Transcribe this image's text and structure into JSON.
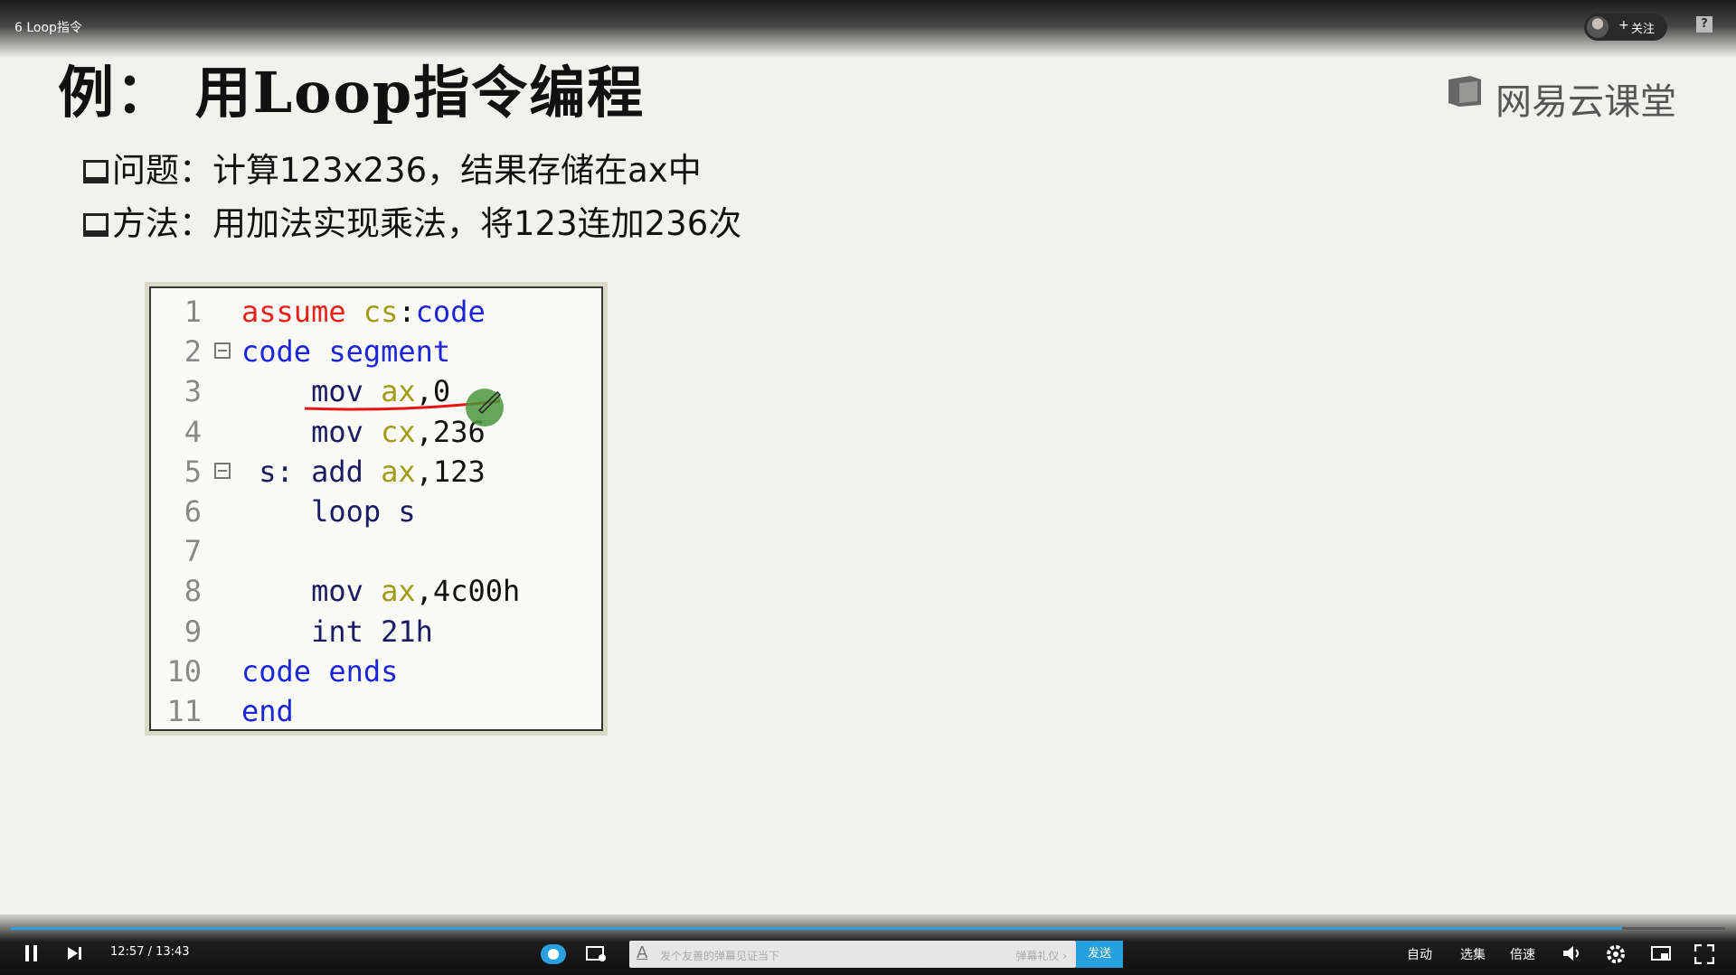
{
  "video": {
    "title": "6 Loop指令"
  },
  "header": {
    "follow_plus": "+",
    "follow_label": "关注",
    "help_label": "?"
  },
  "slide": {
    "heading": "例： 用Loop指令编程",
    "brand": "网易云课堂",
    "bullets": [
      "问题：计算123x236，结果存储在ax中",
      "方法：用加法实现乘法，将123连加236次"
    ],
    "code": {
      "line_numbers": [
        "1",
        "2",
        "3",
        "4",
        "5",
        "6",
        "7",
        "8",
        "9",
        "10",
        "11"
      ],
      "lines": [
        [
          {
            "t": "assume ",
            "c": "red"
          },
          {
            "t": "cs",
            "c": "olive"
          },
          {
            "t": ":",
            "c": "plain"
          },
          {
            "t": "code",
            "c": "blue"
          }
        ],
        [
          {
            "t": "code segment",
            "c": "blue"
          }
        ],
        [
          {
            "t": "    mov ",
            "c": "dark"
          },
          {
            "t": "ax",
            "c": "olive"
          },
          {
            "t": ",0",
            "c": "plain"
          }
        ],
        [
          {
            "t": "    mov ",
            "c": "dark"
          },
          {
            "t": "cx",
            "c": "olive"
          },
          {
            "t": ",236",
            "c": "plain"
          }
        ],
        [
          {
            "t": " s: add ",
            "c": "dark"
          },
          {
            "t": "ax",
            "c": "olive"
          },
          {
            "t": ",123",
            "c": "plain"
          }
        ],
        [
          {
            "t": "    loop s",
            "c": "dark"
          }
        ],
        [],
        [
          {
            "t": "    mov ",
            "c": "dark"
          },
          {
            "t": "ax",
            "c": "olive"
          },
          {
            "t": ",4c00h",
            "c": "plain"
          }
        ],
        [
          {
            "t": "    int 21h",
            "c": "dark"
          }
        ],
        [
          {
            "t": "code ends",
            "c": "blue"
          }
        ],
        [
          {
            "t": "end",
            "c": "blue"
          }
        ]
      ],
      "fold_markers_on_lines": [
        2,
        5
      ]
    }
  },
  "player": {
    "time": "12:57 / 13:43",
    "progress": 0.94,
    "danmu_placeholder": "发个友善的弹幕见证当下",
    "danmu_gift": "弹幕礼仪 ›",
    "send_label": "发送",
    "auto_label": "自动",
    "episodes_label": "选集",
    "speed_label": "倍速",
    "colors": {
      "accent": "#27a0e0",
      "track": "#5c5c5c"
    },
    "icons": [
      "pause-icon",
      "next-icon",
      "danmu-toggle-icon",
      "danmu-settings-icon",
      "volume-icon",
      "gear-icon",
      "pip-icon",
      "fullscreen-icon"
    ]
  }
}
